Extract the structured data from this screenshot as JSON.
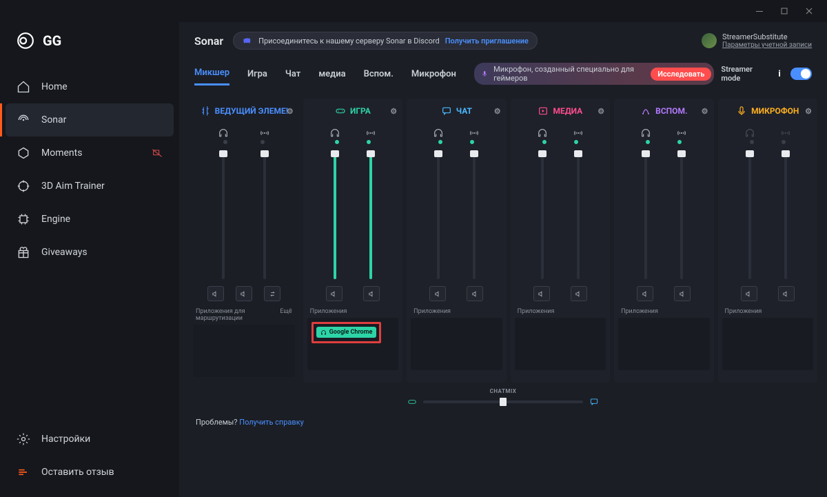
{
  "window": {
    "app_title": "GG"
  },
  "sidebar": {
    "items": [
      {
        "label": "Home"
      },
      {
        "label": "Sonar"
      },
      {
        "label": "Moments"
      },
      {
        "label": "3D Aim Trainer"
      },
      {
        "label": "Engine"
      },
      {
        "label": "Giveaways"
      }
    ],
    "settings_label": "Настройки",
    "feedback_label": "Оставить отзыв"
  },
  "header": {
    "page_title": "Sonar",
    "discord_text": "Присоединитесь к нашему серверу Sonar в Discord",
    "discord_cta": "Получить приглашение",
    "user_name": "StreamerSubstitute",
    "user_sub": "Параметры учетной записи"
  },
  "tabs": {
    "items": [
      "Микшер",
      "Игра",
      "Чат",
      "медиа",
      "Вспом.",
      "Микрофон"
    ],
    "active_index": 0
  },
  "promo": {
    "text": "Микрофон, созданный специально для геймеров",
    "cta": "Исследовать",
    "streamer_mode": "Streamer mode"
  },
  "channels": [
    {
      "name": "ВЕДУЩИЙ ЭЛЕМЕ!",
      "color": "c-blue",
      "dots": [
        false,
        false
      ],
      "lit": false,
      "apps_label": "Приложения для маршрутизации",
      "more": "Ещё",
      "extra_btn": true
    },
    {
      "name": "ИГРА",
      "color": "c-green",
      "dots": [
        true,
        true
      ],
      "lit": true,
      "apps_label": "Приложения",
      "app_chip": "Google Chrome"
    },
    {
      "name": "ЧАТ",
      "color": "c-cyan",
      "dots": [
        true,
        true
      ],
      "lit": false,
      "apps_label": "Приложения"
    },
    {
      "name": "МЕДИА",
      "color": "c-pink",
      "dots": [
        true,
        true
      ],
      "lit": false,
      "apps_label": "Приложения"
    },
    {
      "name": "ВСПОМ.",
      "color": "c-purple",
      "dots": [
        true,
        true
      ],
      "lit": false,
      "apps_label": "Приложения"
    },
    {
      "name": "МИКРОФОН",
      "color": "c-yellow",
      "dots": [
        false,
        false
      ],
      "lit": false,
      "muted": true,
      "apps_label": "Приложения"
    }
  ],
  "chatmix": {
    "label": "CHATMIX"
  },
  "footer": {
    "problems": "Проблемы?",
    "help": "Получить справку"
  }
}
